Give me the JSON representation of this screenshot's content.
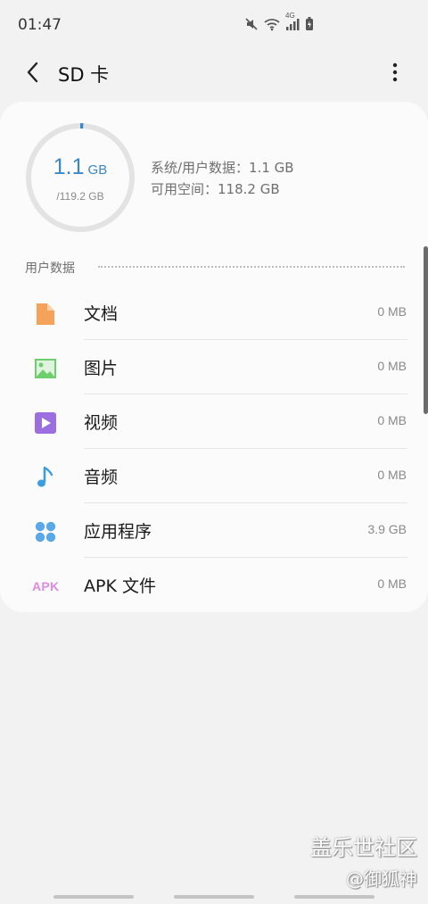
{
  "status_bar": {
    "time": "01:47",
    "network_label": "4G"
  },
  "app_bar": {
    "title": "SD 卡"
  },
  "storage": {
    "used_value": "1.1",
    "used_unit": "GB",
    "total": "/119.2 GB",
    "used_fraction": 0.0092,
    "system_user_data": "系统/用户数据：1.1 GB",
    "available_space": "可用空间：118.2 GB",
    "ring_color": "#3b87c6"
  },
  "section": {
    "title": "用户数据"
  },
  "categories": [
    {
      "name": "文档",
      "size": "0 MB",
      "icon": "document-icon",
      "color": "#f5a35a"
    },
    {
      "name": "图片",
      "size": "0 MB",
      "icon": "image-icon",
      "color": "#6ccf6c"
    },
    {
      "name": "视频",
      "size": "0 MB",
      "icon": "video-icon",
      "color": "#9b6fe0"
    },
    {
      "name": "音频",
      "size": "0 MB",
      "icon": "audio-icon",
      "color": "#3b9ee0"
    },
    {
      "name": "应用程序",
      "size": "3.9 GB",
      "icon": "apps-icon",
      "color": "#5aa8e8"
    },
    {
      "name": "APK 文件",
      "size": "0 MB",
      "icon": "apk-icon",
      "icon_text": "APK",
      "color": "#e08ae0"
    }
  ],
  "watermark": {
    "line1": "盖乐世社区",
    "line2": "@御狐神"
  }
}
